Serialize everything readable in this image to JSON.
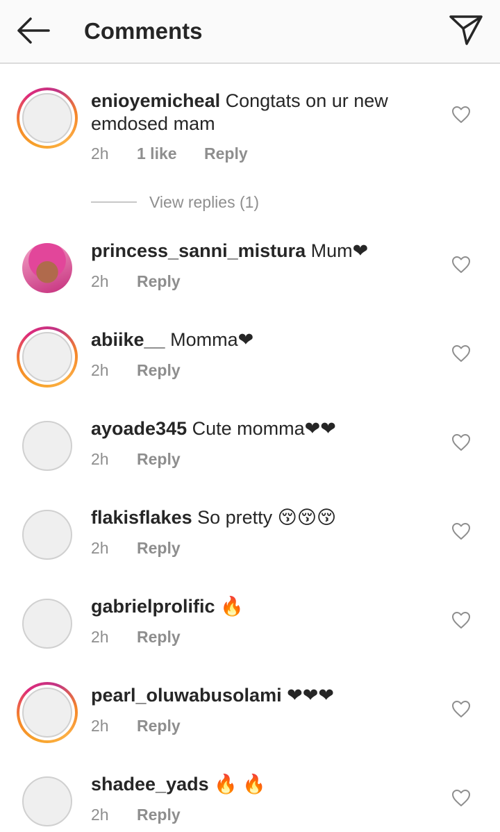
{
  "header": {
    "title": "Comments"
  },
  "icons": {
    "back": "arrow-left-icon",
    "send": "paper-plane-icon",
    "like": "heart-outline-icon"
  },
  "colors": {
    "story_ring_start": "#f58529",
    "story_ring_end": "#c13584",
    "muted_text": "#8e8e8e"
  },
  "comments": [
    {
      "username": "enioyemicheal",
      "text": "Congtats on ur new emdosed mam",
      "time": "2h",
      "likes": "1 like",
      "reply": "Reply",
      "ring": true,
      "avatar": "plain"
    },
    {
      "username": "princess_sanni_mistura",
      "text": "Mum❤",
      "time": "2h",
      "reply": "Reply",
      "ring": false,
      "avatar": "photo"
    },
    {
      "username": "abiike__",
      "text": "Momma❤",
      "time": "2h",
      "reply": "Reply",
      "ring": true,
      "avatar": "plain"
    },
    {
      "username": "ayoade345",
      "text": "Cute momma❤❤",
      "time": "2h",
      "reply": "Reply",
      "ring": false,
      "avatar": "plain"
    },
    {
      "username": "flakisflakes",
      "text": "So pretty 😚😚😚",
      "time": "2h",
      "reply": "Reply",
      "ring": false,
      "avatar": "plain"
    },
    {
      "username": "gabrielprolific",
      "text": "🔥",
      "time": "2h",
      "reply": "Reply",
      "ring": false,
      "avatar": "plain"
    },
    {
      "username": "pearl_oluwabusolami",
      "text": "❤❤❤",
      "time": "2h",
      "reply": "Reply",
      "ring": true,
      "avatar": "plain"
    },
    {
      "username": "shadee_yads",
      "text": "🔥 🔥",
      "time": "2h",
      "reply": "Reply",
      "ring": false,
      "avatar": "plain"
    }
  ],
  "view_replies": {
    "label": "View replies (1)"
  }
}
